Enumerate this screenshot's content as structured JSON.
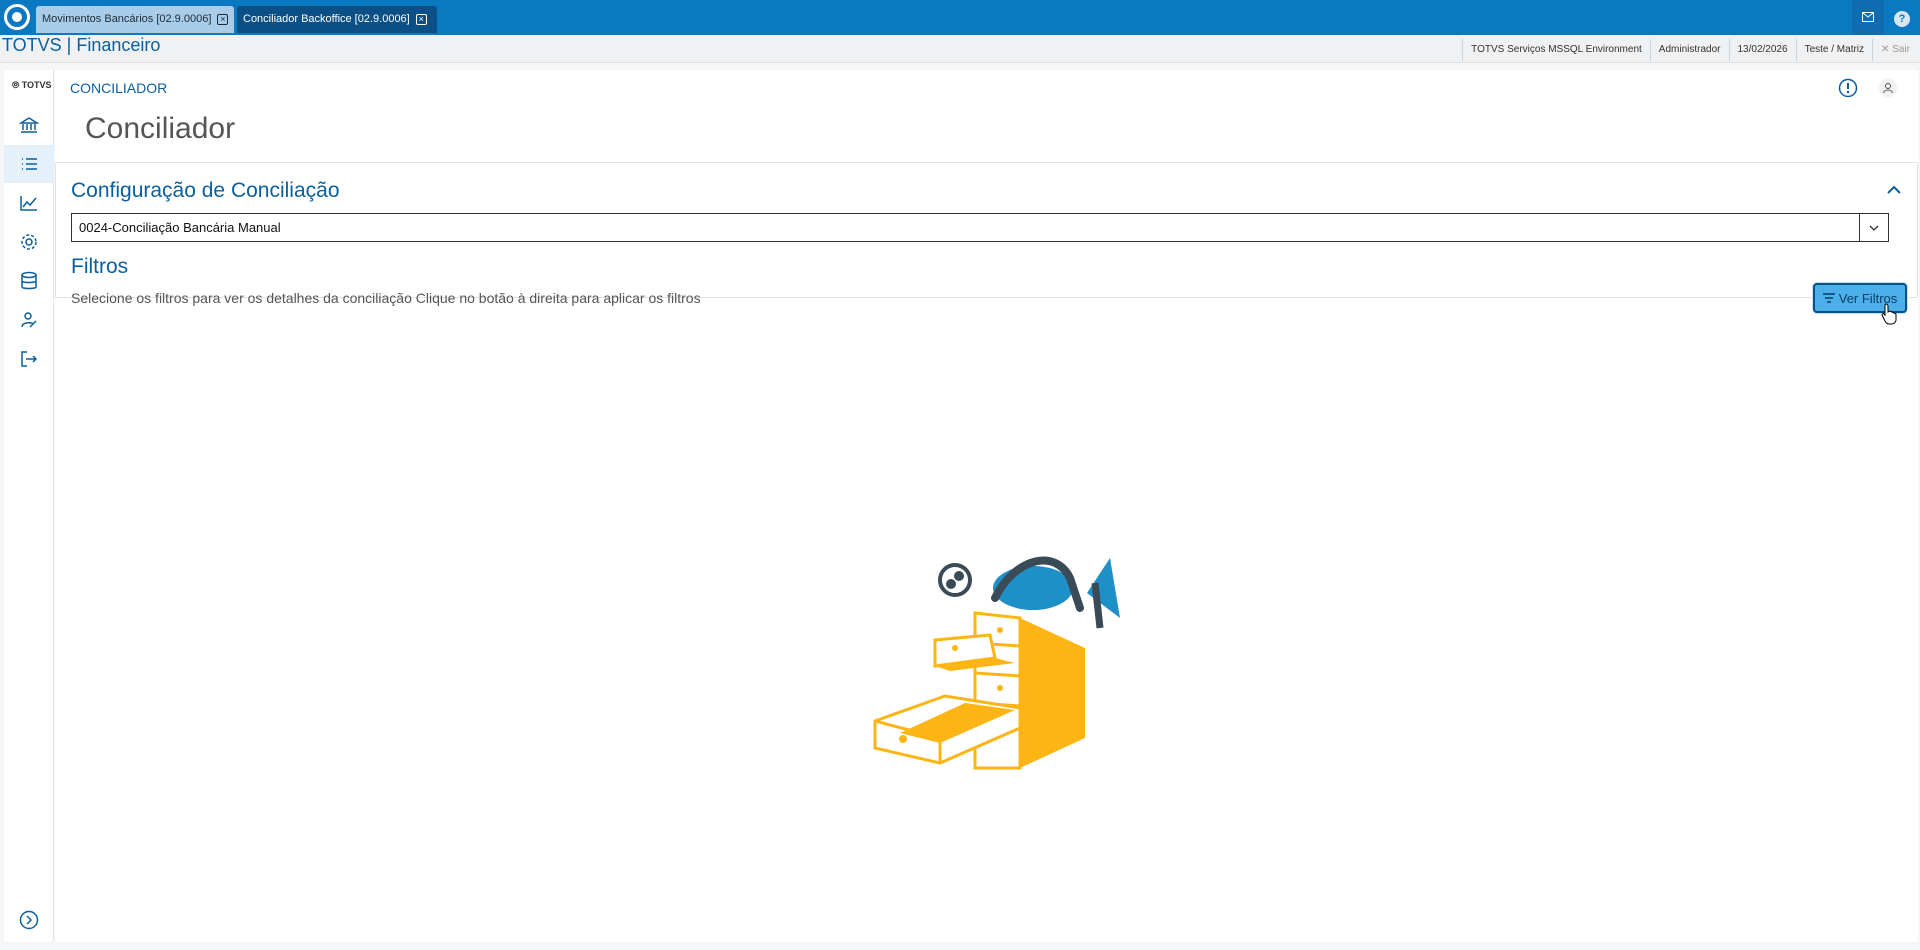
{
  "tabs": [
    {
      "label": "Movimentos Bancários [02.9.0006]",
      "active": false
    },
    {
      "label": "Conciliador Backoffice [02.9.0006]",
      "active": true
    }
  ],
  "header": {
    "brand": "TOTVS | Financeiro",
    "environment": "TOTVS Serviços MSSQL Environment",
    "user": "Administrador",
    "date": "13/02/2026",
    "branch": "Teste / Matriz",
    "exit_label": "Sair"
  },
  "sidebar": {
    "logo": "TOTVS",
    "items": [
      {
        "icon": "bank-icon",
        "active": false
      },
      {
        "icon": "list-icon",
        "active": true
      },
      {
        "icon": "chart-line-icon",
        "active": false
      },
      {
        "icon": "gear-icon",
        "active": false
      },
      {
        "icon": "database-icon",
        "active": false
      },
      {
        "icon": "user-edit-icon",
        "active": false
      },
      {
        "icon": "logout-icon",
        "active": false
      }
    ],
    "expand_icon": "chevron-right-circle-icon"
  },
  "main": {
    "breadcrumb": "CONCILIADOR",
    "title": "Conciliador",
    "config": {
      "title": "Configuração de Conciliação",
      "selected": "0024-Conciliação Bancária Manual"
    },
    "filters": {
      "title": "Filtros",
      "description": "Selecione os filtros para ver os detalhes da conciliação Clique no botão à direita para aplicar os filtros",
      "button_label": "Ver Filtros"
    }
  },
  "colors": {
    "tabbar": "#0b78c2",
    "accent": "#0b5f9c",
    "button": "#4bb0ea",
    "illustration_yellow": "#fdb515",
    "illustration_teal": "#1d90c7"
  }
}
